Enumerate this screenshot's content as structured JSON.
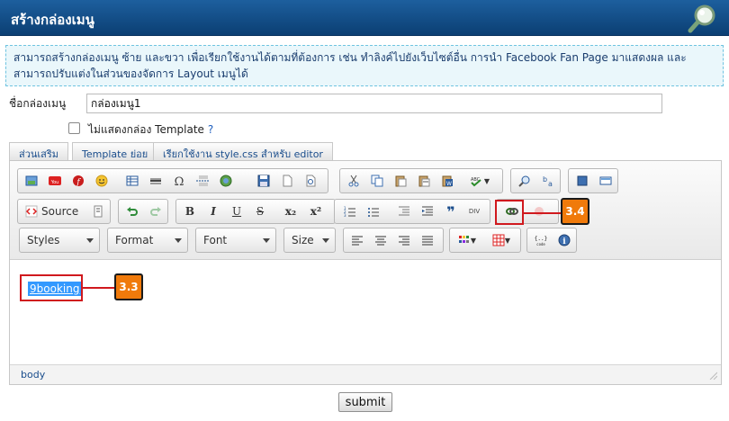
{
  "header": {
    "title": "สร้างกล่องเมนู"
  },
  "info_text": "สามารถสร้างกล่องเมนู ซ้าย และขวา เพื่อเรียกใช้งานได้ตามที่ต้องการ เช่น ทำลิงค์ไปยังเว็บไซต์อื่น การนำ Facebook Fan Page มาแสดงผล และ สามารถปรับแต่งในส่วนของจัดการ Layout เมนูได้",
  "form": {
    "name_label": "ชื่อกล่องเมนู",
    "name_value": "กล่องเมนู1",
    "hide_template_label": "ไม่แสดงกล่อง Template",
    "help_mark": "?"
  },
  "tabs": [
    "ส่วนเสริม",
    "Template ย่อย",
    "เรียกใช้งาน style.css สำหรับ editor"
  ],
  "toolbar": {
    "source_label": "Source",
    "bold": "B",
    "italic": "I",
    "underline": "U",
    "strike": "S",
    "subscript": "x₂",
    "superscript": "x²",
    "quote": "❞",
    "div": "DIV",
    "styles": "Styles",
    "format": "Format",
    "font": "Font",
    "size": "Size"
  },
  "editor": {
    "content_text": "9booking",
    "status_path": "body"
  },
  "callouts": {
    "step_a": "3.3",
    "step_b": "3.4"
  },
  "submit_label": "submit"
}
